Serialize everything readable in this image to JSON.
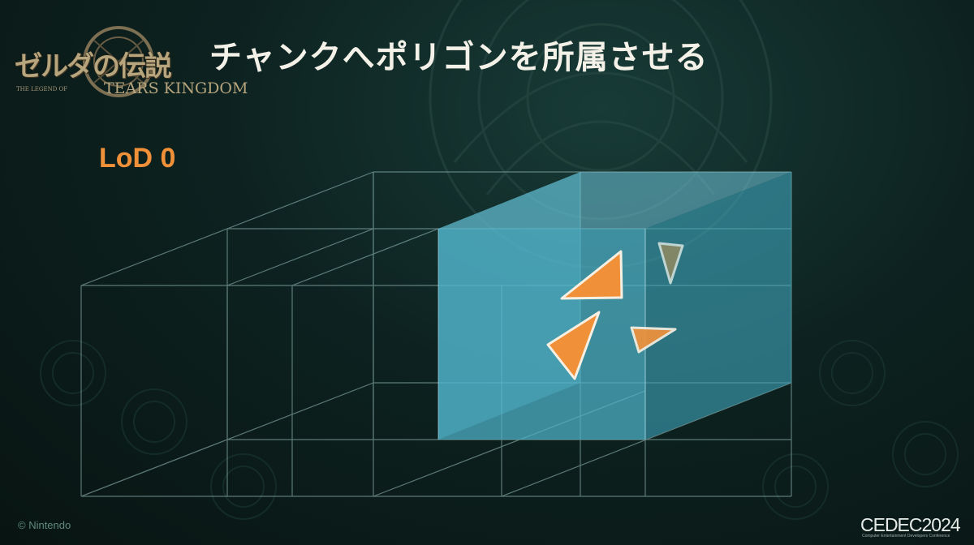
{
  "slide": {
    "title": "チャンクへポリゴンを所属させる",
    "lod_label": "LoD 0",
    "logo": {
      "main": "ゼルダの伝説",
      "small": "THE LEGEND OF",
      "sub": "TEARS KINGDOM"
    },
    "copyright": "© Nintendo",
    "event": {
      "name": "CEDEC2024",
      "tagline": "Computer Entertainment Developers Conference"
    }
  },
  "colors": {
    "background": "#0d2220",
    "highlight_volume": "#4fb4cc",
    "triangle_fill": "#f0913a",
    "title_text": "#f4f1e8",
    "lod_text": "#f0913a",
    "grid_line": "#9fc6c4"
  },
  "diagram": {
    "description_type": "chunk grid with highlighted chunk volume containing triangles",
    "triangle_count": 4
  }
}
